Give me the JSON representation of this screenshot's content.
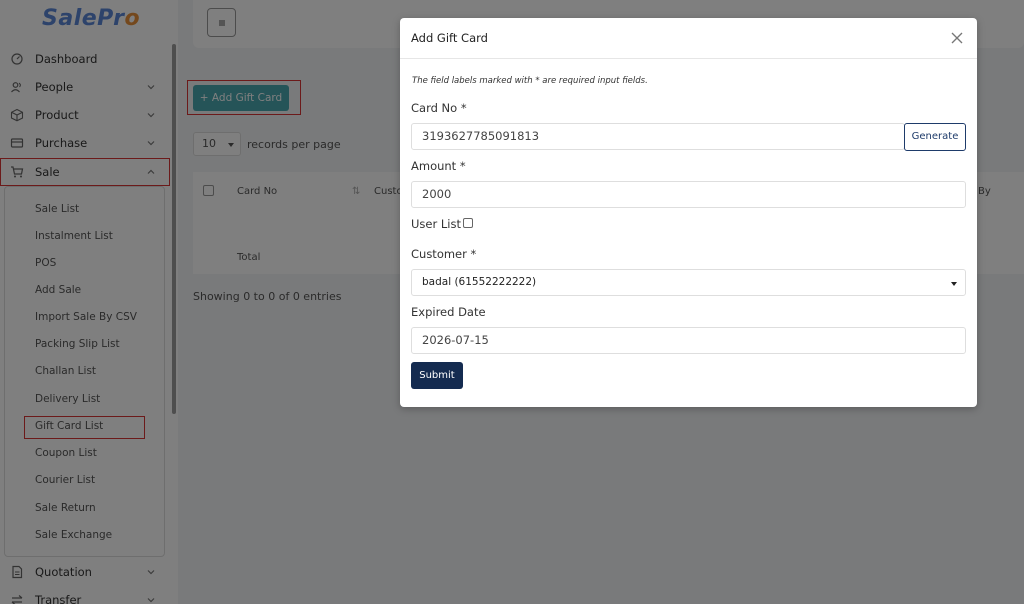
{
  "app": {
    "logo_main": "SalePr",
    "logo_o": "o"
  },
  "sidebar": {
    "items": [
      {
        "label": "Dashboard",
        "icon": "gauge-icon"
      },
      {
        "label": "People",
        "icon": "users-icon"
      },
      {
        "label": "Product",
        "icon": "cube-icon"
      },
      {
        "label": "Purchase",
        "icon": "card-icon"
      },
      {
        "label": "Sale",
        "icon": "cart-icon"
      },
      {
        "label": "Quotation",
        "icon": "document-icon"
      },
      {
        "label": "Transfer",
        "icon": "transfer-icon"
      }
    ],
    "sale_submenu": [
      "Sale List",
      "Instalment List",
      "POS",
      "Add Sale",
      "Import Sale By CSV",
      "Packing Slip List",
      "Challan List",
      "Delivery List",
      "Gift Card List",
      "Coupon List",
      "Courier List",
      "Sale Return",
      "Sale Exchange"
    ]
  },
  "page": {
    "add_button": "+ Add Gift Card",
    "records_value": "10",
    "records_label": "records per page",
    "table_headers": [
      "Card No",
      "Custo",
      "By"
    ],
    "total_label": "Total",
    "showing": "Showing 0 to 0 of 0 entries"
  },
  "modal": {
    "title": "Add Gift Card",
    "note": "The field labels marked with * are required input fields.",
    "card_no_label": "Card No *",
    "card_no_value": "3193627785091813",
    "generate_label": "Generate",
    "amount_label": "Amount *",
    "amount_value": "2000",
    "user_list_label": "User List",
    "customer_label": "Customer *",
    "customer_value": "badal (61552222222)",
    "expired_label": "Expired Date",
    "expired_value": "2026-07-15",
    "submit_label": "Submit"
  },
  "colors": {
    "accent_teal": "#4ba8b0",
    "primary_navy": "#142b50",
    "highlight_red": "#d93434",
    "logo_blue": "#5a86d6",
    "logo_orange": "#e8913a"
  }
}
